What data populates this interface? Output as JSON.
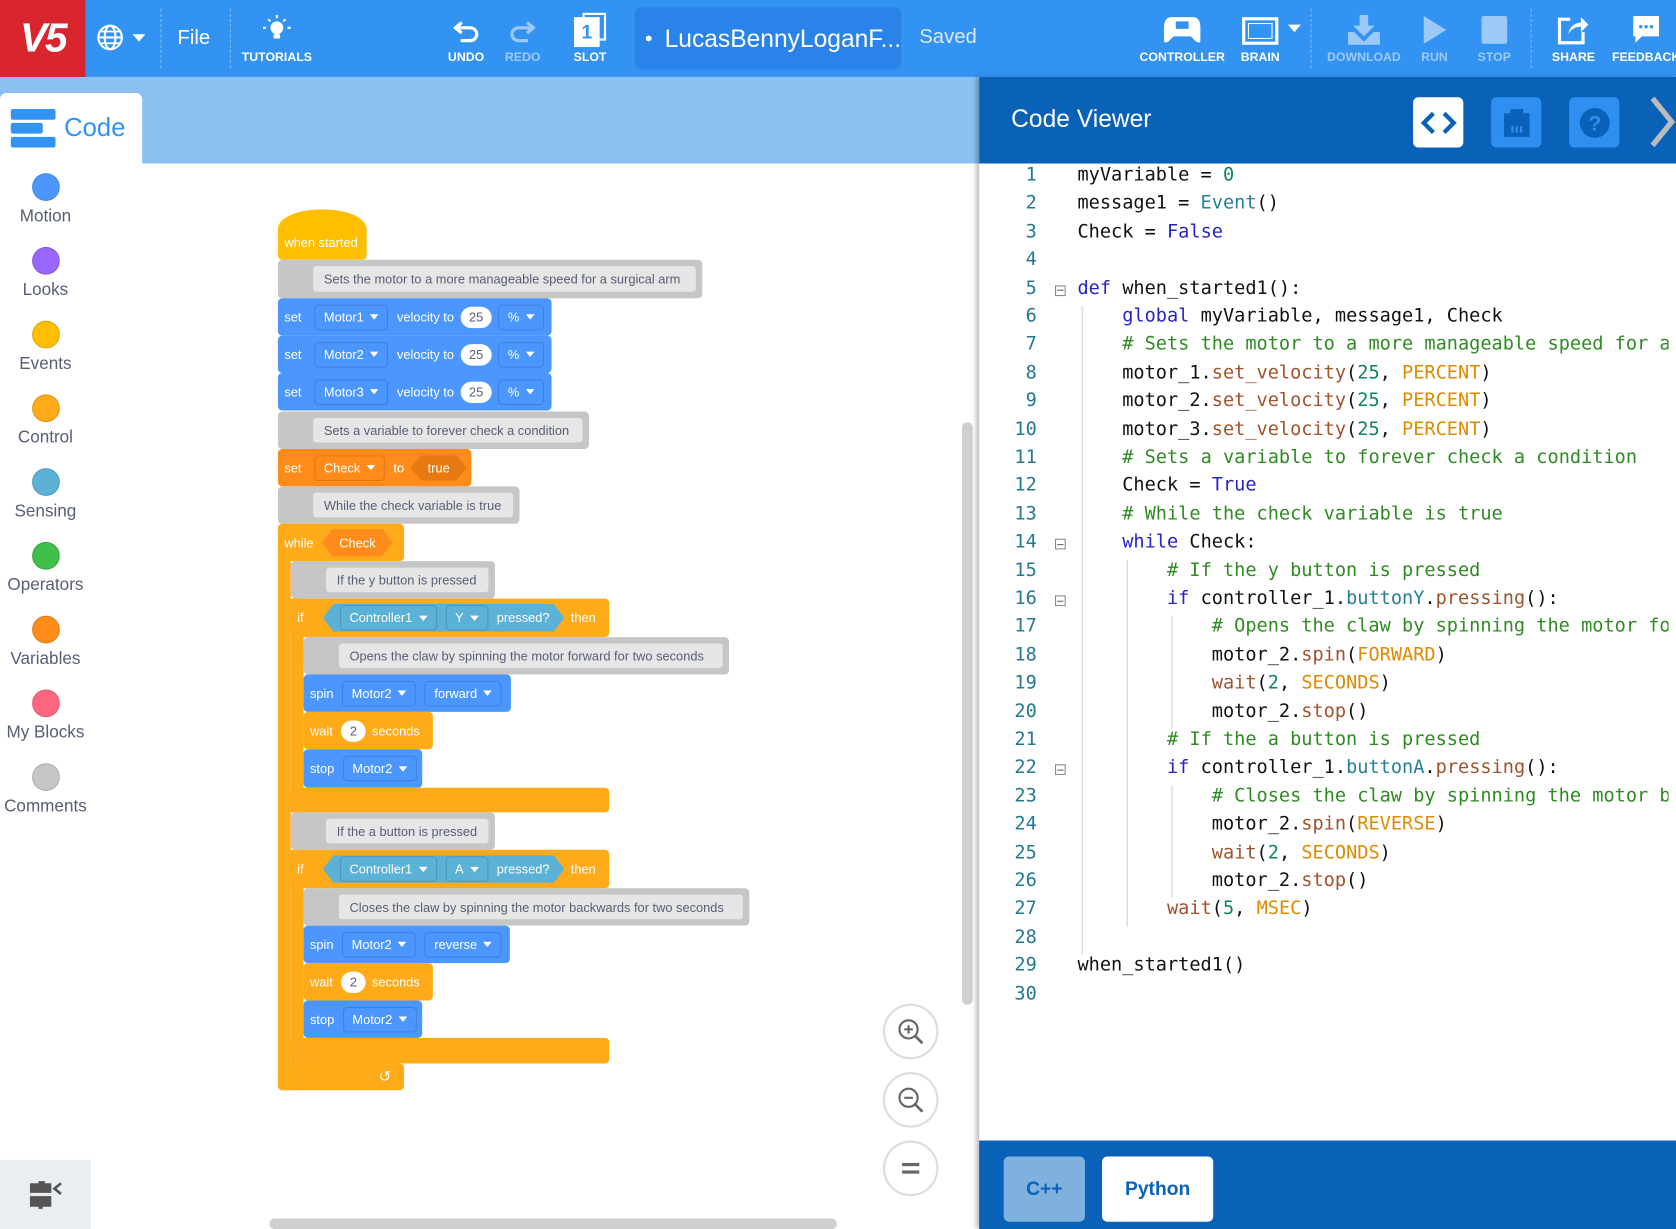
{
  "topbar": {
    "logo": "V5",
    "file": "File",
    "tutorials": "TUTORIALS",
    "undo": "UNDO",
    "redo": "REDO",
    "slot": "SLOT",
    "slot_number": "1",
    "project_name": "LucasBennyLoganF...",
    "save_status": "Saved",
    "controller": "CONTROLLER",
    "brain": "BRAIN",
    "download": "DOWNLOAD",
    "run": "RUN",
    "stop": "STOP",
    "share": "SHARE",
    "feedback": "FEEDBACK"
  },
  "code_tab": "Code",
  "categories": [
    {
      "label": "Motion",
      "color": "#4c97ff"
    },
    {
      "label": "Looks",
      "color": "#9966ff"
    },
    {
      "label": "Events",
      "color": "#ffbf00"
    },
    {
      "label": "Control",
      "color": "#ffab19"
    },
    {
      "label": "Sensing",
      "color": "#5cb1d6"
    },
    {
      "label": "Operators",
      "color": "#40bf4a"
    },
    {
      "label": "Variables",
      "color": "#ff8c1a"
    },
    {
      "label": "My Blocks",
      "color": "#ff6680"
    },
    {
      "label": "Comments",
      "color": "#c6c6c6"
    }
  ],
  "blocks": {
    "when_started": "when started",
    "c1": "Sets the motor to a more manageable speed for a surgical arm",
    "set": "set",
    "motors": [
      "Motor1",
      "Motor2",
      "Motor3"
    ],
    "velocity_to": "velocity to",
    "velocity": "25",
    "unit": "%",
    "c2": "Sets a variable to forever check a condition",
    "var_name": "Check",
    "to": "to",
    "bool": "true",
    "c3": "While the check variable is true",
    "while": "while",
    "c4": "If the y button is pressed",
    "if": "if",
    "controller": "Controller1",
    "button_y": "Y",
    "button_a": "A",
    "pressed": "pressed?",
    "then": "then",
    "c5": "Opens the claw by spinning the motor forward for two seconds",
    "spin": "spin",
    "spin_motor": "Motor2",
    "forward": "forward",
    "reverse": "reverse",
    "wait": "wait",
    "wait_value": "2",
    "seconds": "seconds",
    "stop": "stop",
    "c6": "If the a button is pressed",
    "c7": "Closes the claw by spinning the motor backwards for two seconds",
    "loop_arrow": "↺"
  },
  "code_viewer": {
    "title": "Code Viewer",
    "languages": [
      "C++",
      "Python"
    ],
    "selected_language": "Python",
    "lines": [
      [
        [
          "myVariable = ",
          ""
        ],
        [
          "0",
          "n"
        ]
      ],
      [
        [
          "message1 = ",
          ""
        ],
        [
          "Event",
          "f"
        ],
        [
          "()",
          ""
        ]
      ],
      [
        [
          "Check = ",
          ""
        ],
        [
          "False",
          "k"
        ]
      ],
      [],
      [
        [
          "def",
          "k"
        ],
        [
          " when_started1():",
          ""
        ]
      ],
      [
        [
          "    ",
          ""
        ],
        [
          "global",
          "k"
        ],
        [
          " myVariable, message1, Check",
          ""
        ]
      ],
      [
        [
          "    ",
          ""
        ],
        [
          "# Sets the motor to a more manageable speed for a",
          "c"
        ]
      ],
      [
        [
          "    motor_1.",
          ""
        ],
        [
          "set_velocity",
          "m"
        ],
        [
          "(",
          ""
        ],
        [
          "25",
          "n"
        ],
        [
          ", ",
          ""
        ],
        [
          "PERCENT",
          "p"
        ],
        [
          ")",
          ""
        ]
      ],
      [
        [
          "    motor_2.",
          ""
        ],
        [
          "set_velocity",
          "m"
        ],
        [
          "(",
          ""
        ],
        [
          "25",
          "n"
        ],
        [
          ", ",
          ""
        ],
        [
          "PERCENT",
          "p"
        ],
        [
          ")",
          ""
        ]
      ],
      [
        [
          "    motor_3.",
          ""
        ],
        [
          "set_velocity",
          "m"
        ],
        [
          "(",
          ""
        ],
        [
          "25",
          "n"
        ],
        [
          ", ",
          ""
        ],
        [
          "PERCENT",
          "p"
        ],
        [
          ")",
          ""
        ]
      ],
      [
        [
          "    ",
          ""
        ],
        [
          "# Sets a variable to forever check a condition",
          "c"
        ]
      ],
      [
        [
          "    Check = ",
          ""
        ],
        [
          "True",
          "k"
        ]
      ],
      [
        [
          "    ",
          ""
        ],
        [
          "# While the check variable is true",
          "c"
        ]
      ],
      [
        [
          "    ",
          ""
        ],
        [
          "while",
          "k"
        ],
        [
          " Check:",
          ""
        ]
      ],
      [
        [
          "        ",
          ""
        ],
        [
          "# If the y button is pressed",
          "c"
        ]
      ],
      [
        [
          "        ",
          ""
        ],
        [
          "if",
          "k"
        ],
        [
          " controller_1.",
          ""
        ],
        [
          "buttonY",
          "f"
        ],
        [
          ".",
          ""
        ],
        [
          "pressing",
          "m"
        ],
        [
          "():",
          ""
        ]
      ],
      [
        [
          "            ",
          ""
        ],
        [
          "# Opens the claw by spinning the motor fo",
          "c"
        ]
      ],
      [
        [
          "            motor_2.",
          ""
        ],
        [
          "spin",
          "m"
        ],
        [
          "(",
          ""
        ],
        [
          "FORWARD",
          "p"
        ],
        [
          ")",
          ""
        ]
      ],
      [
        [
          "            ",
          ""
        ],
        [
          "wait",
          "m"
        ],
        [
          "(",
          ""
        ],
        [
          "2",
          "n"
        ],
        [
          ", ",
          ""
        ],
        [
          "SECONDS",
          "p"
        ],
        [
          ")",
          ""
        ]
      ],
      [
        [
          "            motor_2.",
          ""
        ],
        [
          "stop",
          "m"
        ],
        [
          "()",
          ""
        ]
      ],
      [
        [
          "        ",
          ""
        ],
        [
          "# If the a button is pressed",
          "c"
        ]
      ],
      [
        [
          "        ",
          ""
        ],
        [
          "if",
          "k"
        ],
        [
          " controller_1.",
          ""
        ],
        [
          "buttonA",
          "f"
        ],
        [
          ".",
          ""
        ],
        [
          "pressing",
          "m"
        ],
        [
          "():",
          ""
        ]
      ],
      [
        [
          "            ",
          ""
        ],
        [
          "# Closes the claw by spinning the motor b",
          "c"
        ]
      ],
      [
        [
          "            motor_2.",
          ""
        ],
        [
          "spin",
          "m"
        ],
        [
          "(",
          ""
        ],
        [
          "REVERSE",
          "p"
        ],
        [
          ")",
          ""
        ]
      ],
      [
        [
          "            ",
          ""
        ],
        [
          "wait",
          "m"
        ],
        [
          "(",
          ""
        ],
        [
          "2",
          "n"
        ],
        [
          ", ",
          ""
        ],
        [
          "SECONDS",
          "p"
        ],
        [
          ")",
          ""
        ]
      ],
      [
        [
          "            motor_2.",
          ""
        ],
        [
          "stop",
          "m"
        ],
        [
          "()",
          ""
        ]
      ],
      [
        [
          "        ",
          ""
        ],
        [
          "wait",
          "m"
        ],
        [
          "(",
          ""
        ],
        [
          "5",
          "n"
        ],
        [
          ", ",
          ""
        ],
        [
          "MSEC",
          "p"
        ],
        [
          ")",
          ""
        ]
      ],
      [],
      [
        [
          "when_started1()",
          ""
        ]
      ],
      []
    ]
  }
}
